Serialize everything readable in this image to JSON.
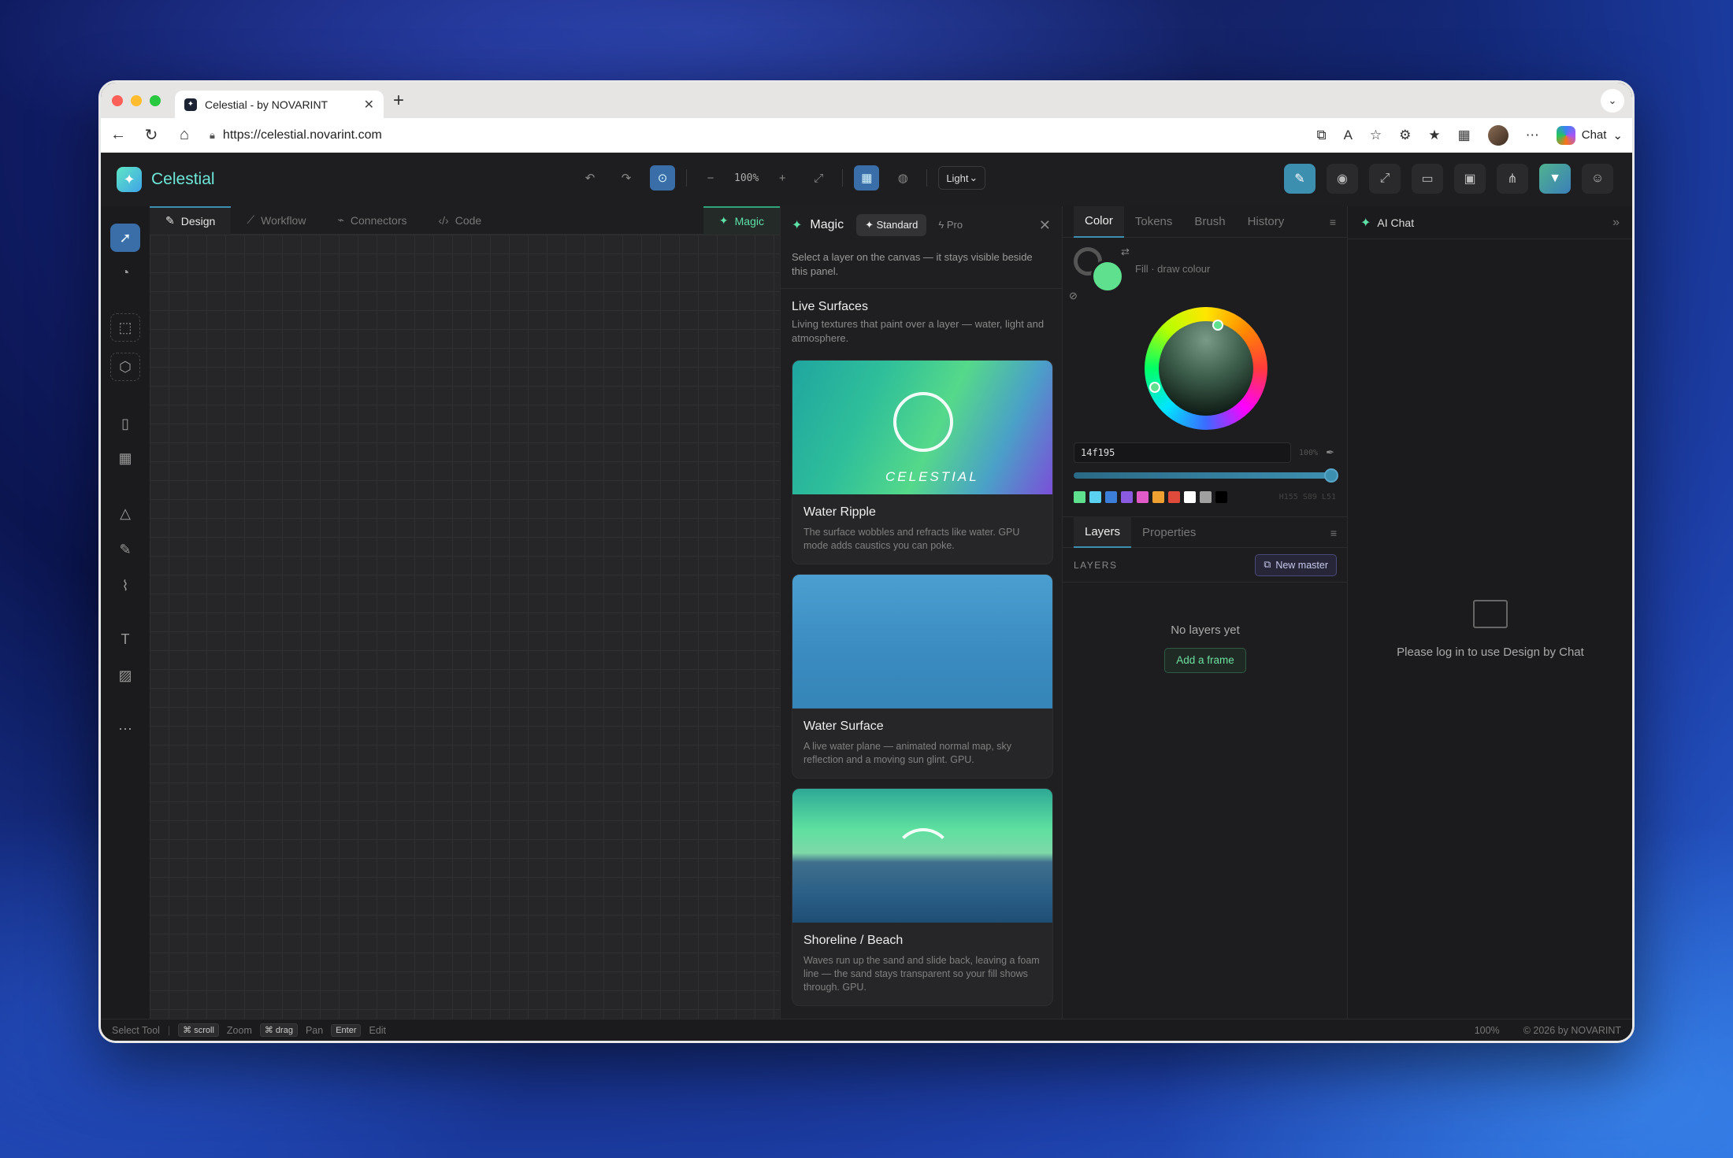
{
  "browser": {
    "tab_title": "Celestial - by NOVARINT",
    "url": "https://celestial.novarint.com",
    "chat_label": "Chat"
  },
  "app": {
    "name": "Celestial",
    "zoom": "100%",
    "theme": "Light",
    "view_tabs": [
      {
        "label": "Design"
      },
      {
        "label": "Workflow"
      },
      {
        "label": "Connectors"
      },
      {
        "label": "Code"
      }
    ],
    "magic_tab": "Magic"
  },
  "magic": {
    "title": "Magic",
    "modes": [
      "Standard",
      "Pro"
    ],
    "hint": "Select a layer on the canvas — it stays visible beside this panel.",
    "section_title": "Live Surfaces",
    "section_desc": "Living textures that paint over a layer — water, light and atmosphere.",
    "cards": [
      {
        "title": "Water Ripple",
        "desc": "The surface wobbles and refracts like water. GPU mode adds caustics you can poke.",
        "image_text": "CELESTIAL"
      },
      {
        "title": "Water Surface",
        "desc": "A live water plane — animated normal map, sky reflection and a moving sun glint. GPU."
      },
      {
        "title": "Shoreline / Beach",
        "desc": "Waves run up the sand and slide back, leaving a foam line — the sand stays transparent so your fill shows through. GPU."
      }
    ]
  },
  "color_panel": {
    "tabs": [
      "Color",
      "Tokens",
      "Brush",
      "History"
    ],
    "fill_label": "Fill · draw colour",
    "hex": "14f195",
    "opacity": "100%",
    "hsl": "H155 S89 L51",
    "palette": [
      "#5ee08f",
      "#5ad1f0",
      "#3b7fd8",
      "#8a5be0",
      "#e05ac8",
      "#f0a030",
      "#e04a3a",
      "#ffffff",
      "#a0a0a0",
      "#000000"
    ],
    "accent_fill": "#5ee08f"
  },
  "layers": {
    "tabs": [
      "Layers",
      "Properties"
    ],
    "section_label": "LAYERS",
    "new_master": "New master",
    "empty_msg": "No layers yet",
    "add_frame": "Add a frame"
  },
  "chat": {
    "title": "AI Chat",
    "login_msg": "Please log in to use Design by Chat"
  },
  "status": {
    "tool": "Select Tool",
    "hints": [
      {
        "key": "⌘ scroll",
        "action": "Zoom"
      },
      {
        "key": "⌘ drag",
        "action": "Pan"
      },
      {
        "key": "Enter",
        "action": "Edit"
      }
    ],
    "zoom": "100%",
    "copyright": "© 2026 by NOVARINT"
  }
}
